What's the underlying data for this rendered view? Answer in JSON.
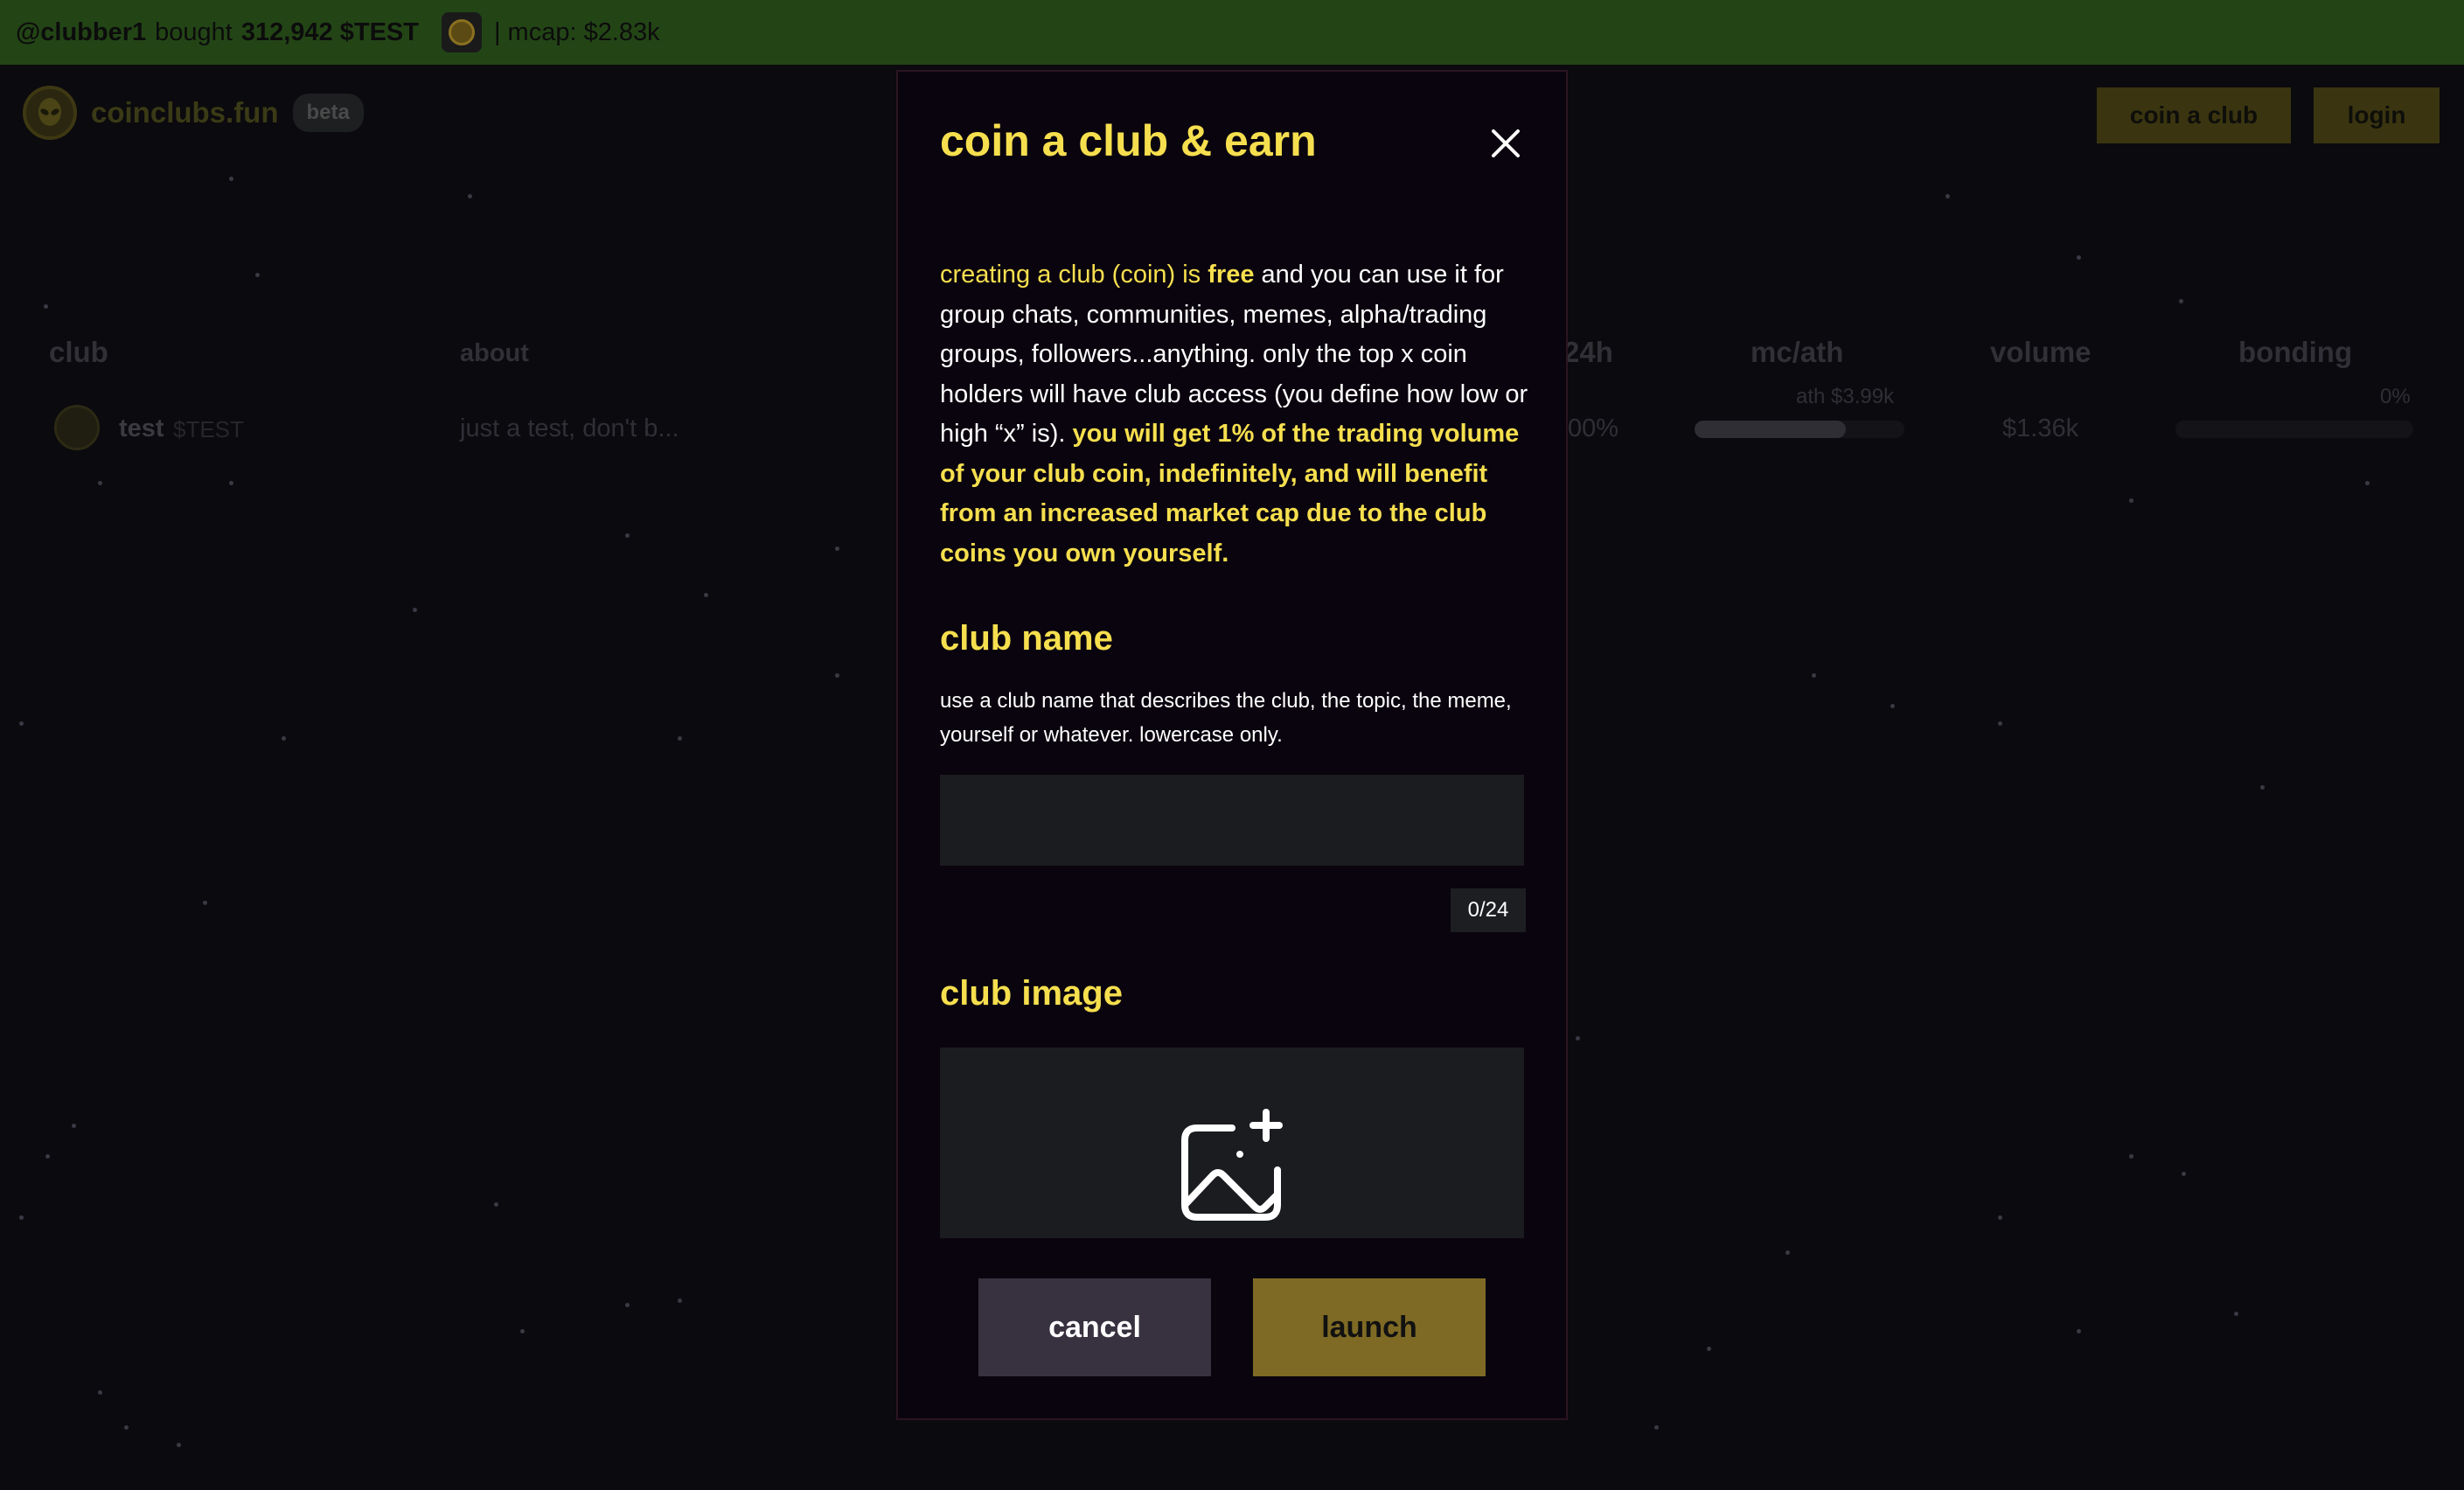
{
  "ticker": {
    "user": "@clubber1",
    "verb": "bought",
    "amount": "312,942 $TEST",
    "sep": "|",
    "mcap": "mcap: $2.83k"
  },
  "header": {
    "brand": "coinclubs.fun",
    "badge": "beta",
    "coin_club_label": "coin a club",
    "login_label": "login"
  },
  "table": {
    "columns": {
      "club": "club",
      "about": "about",
      "change": "24h",
      "mc_ath": "mc/ath",
      "volume": "volume",
      "bonding": "bonding"
    },
    "rows": [
      {
        "name": "test",
        "ticker": "$TEST",
        "about": "just a test, don't b...",
        "change": "00%",
        "ath": "ath $3.99k",
        "mc_progress": 0.72,
        "volume": "$1.36k",
        "bonding_pct": "0%",
        "bonding_progress": 0
      }
    ]
  },
  "modal": {
    "title": "coin a club & earn",
    "intro": {
      "part1": "creating a club (coin) is ",
      "part2": "free",
      "part3": " and you can use it for group chats, communities, memes, alpha/trading groups, followers...anything. only the top x coin holders will have club access (you define how low or high “x” is). ",
      "part4": "you will get 1% of the trading volume of your club coin, indefinitely, and will benefit from an increased market cap due to the club coins you own yourself."
    },
    "name_heading": "club name",
    "name_help": "use a club name that describes the club, the topic, the meme, yourself or whatever. lowercase only.",
    "name_value": "",
    "name_counter": "0/24",
    "image_heading": "club image",
    "cancel_label": "cancel",
    "launch_label": "launch"
  },
  "colors": {
    "accent": "#f6df4e",
    "ticker_bg": "#234516",
    "modal_bg": "#0a040e",
    "launch_bg": "#7e6a24",
    "cancel_bg": "#38313f"
  },
  "icons": {
    "close": "close-icon",
    "upload": "image-plus-icon",
    "logo": "alien-icon"
  }
}
